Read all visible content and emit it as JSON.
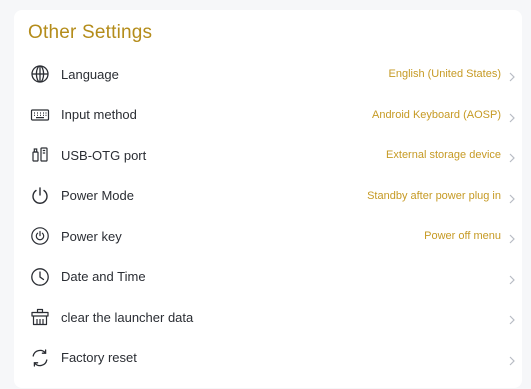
{
  "section": {
    "title": "Other Settings"
  },
  "colors": {
    "accent": "#c69a24",
    "title": "#b48c1a",
    "text": "#2a2d33",
    "chevron": "#b8bcc4"
  },
  "items": [
    {
      "label": "Language",
      "value": "English (United States)",
      "icon": "globe-icon"
    },
    {
      "label": "Input method",
      "value": "Android Keyboard (AOSP)",
      "icon": "keyboard-icon"
    },
    {
      "label": "USB-OTG port",
      "value": "External storage device",
      "icon": "usb-otg-icon"
    },
    {
      "label": "Power Mode",
      "value": "Standby after power plug in",
      "icon": "power-icon"
    },
    {
      "label": "Power key",
      "value": "Power off menu",
      "icon": "power-key-icon"
    },
    {
      "label": "Date and Time",
      "value": "",
      "icon": "clock-icon"
    },
    {
      "label": "clear the launcher data",
      "value": "",
      "icon": "basket-icon"
    },
    {
      "label": "Factory reset",
      "value": "",
      "icon": "reset-icon"
    }
  ]
}
